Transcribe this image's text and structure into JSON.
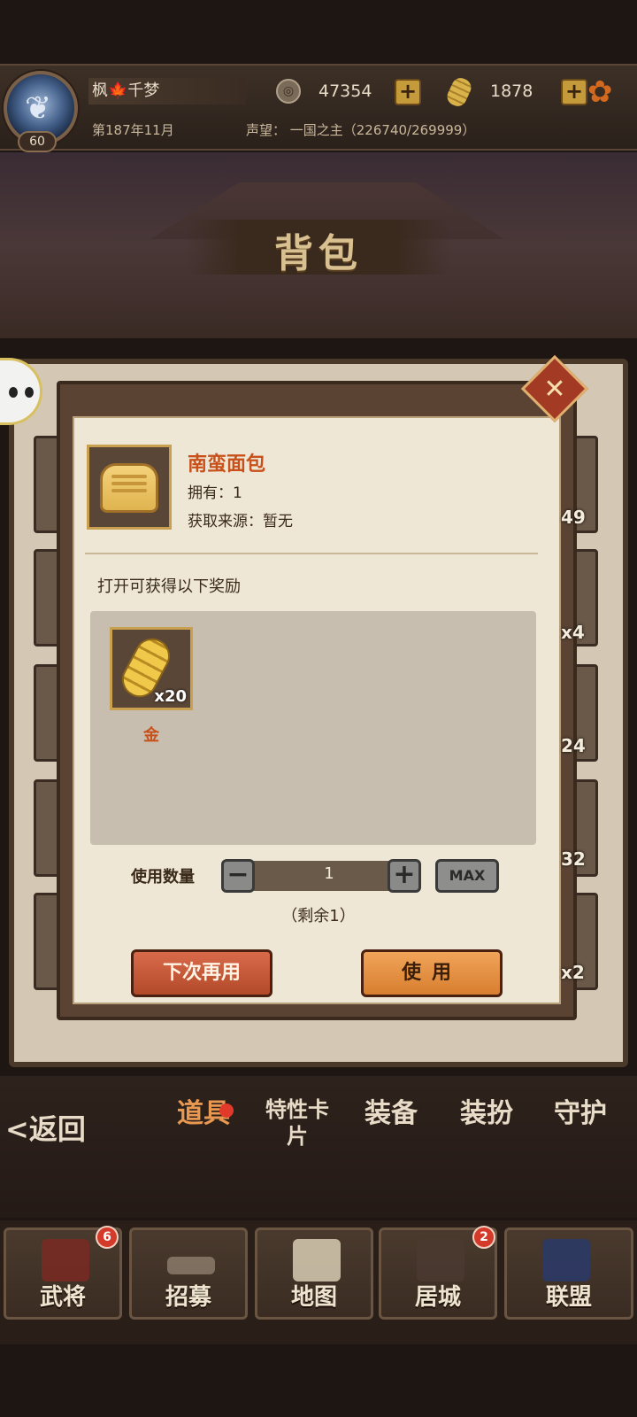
{
  "player": {
    "name": "枫🍁千梦",
    "level": "60",
    "date": "第187年11月",
    "fame": "声望： 一国之主（226740/269999）"
  },
  "resources": {
    "gold_value": "47354",
    "koban_value": "1878",
    "plus_symbol": "+"
  },
  "page": {
    "title": "背包"
  },
  "inventory_counts": [
    "49",
    "x4",
    "24",
    "32",
    "x2"
  ],
  "dialog": {
    "close_symbol": "✕",
    "item_name": "南蛮面包",
    "owned": "拥有：1",
    "source": "获取来源：暂无",
    "reward_heading": "打开可获得以下奖励",
    "reward": {
      "name": "金",
      "qty": "x20"
    },
    "qty_label": "使用数量",
    "qty_value": "1",
    "minus": "−",
    "plus": "+",
    "max": "MAX",
    "remaining": "（剩余1）",
    "btn_later": "下次再用",
    "btn_use": "使用"
  },
  "tabs": {
    "back": "<返回",
    "items": [
      {
        "label": "道具",
        "active": true,
        "has_dot": true
      },
      {
        "label": "特性卡片",
        "active": false
      },
      {
        "label": "装备",
        "active": false
      },
      {
        "label": "装扮",
        "active": false
      },
      {
        "label": "守护",
        "active": false
      }
    ]
  },
  "bottom_nav": [
    {
      "label": "武将",
      "badge": "6",
      "icon": "samurai-helmet-icon"
    },
    {
      "label": "招募",
      "icon": "katana-icon"
    },
    {
      "label": "地图",
      "icon": "scroll-map-icon"
    },
    {
      "label": "居城",
      "badge": "2",
      "icon": "castle-icon"
    },
    {
      "label": "联盟",
      "icon": "banner-icon"
    }
  ],
  "colors": {
    "accent": "#c8501a",
    "panel": "#efe7d6",
    "frame": "#5a4332"
  }
}
